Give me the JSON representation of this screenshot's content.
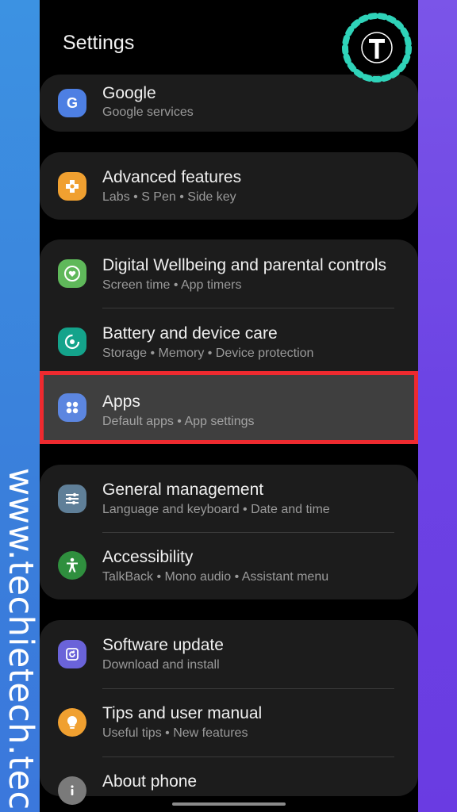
{
  "header": {
    "title": "Settings"
  },
  "watermark": {
    "text": "www.techietech.tech",
    "logo_letter": "T"
  },
  "colors": {
    "highlight_border": "#ee2a2f",
    "google_icon": "#4d7fe3",
    "advanced_icon": "#f0a030",
    "wellbeing_icon": "#5fb85a",
    "battery_icon": "#14a38b",
    "apps_icon": "#5c86e0",
    "general_icon": "#5f7f98",
    "accessibility_icon": "#2f8f3e",
    "software_icon": "#6a63d9",
    "tips_icon": "#f0a030",
    "about_icon": "#7a7a7a"
  },
  "items": [
    {
      "title": "Google",
      "subtitle": "Google services",
      "icon": "google-g-icon"
    },
    {
      "title": "Advanced features",
      "subtitle": "Labs  •  S Pen  •  Side key",
      "icon": "puzzle-plus-icon"
    },
    {
      "title": "Digital Wellbeing and parental controls",
      "subtitle": "Screen time  •  App timers",
      "icon": "wellbeing-heart-icon"
    },
    {
      "title": "Battery and device care",
      "subtitle": "Storage  •  Memory  •  Device protection",
      "icon": "device-care-icon"
    },
    {
      "title": "Apps",
      "subtitle": "Default apps  •  App settings",
      "icon": "apps-grid-icon"
    },
    {
      "title": "General management",
      "subtitle": "Language and keyboard  •  Date and time",
      "icon": "sliders-icon"
    },
    {
      "title": "Accessibility",
      "subtitle": "TalkBack  •  Mono audio  •  Assistant menu",
      "icon": "accessibility-person-icon"
    },
    {
      "title": "Software update",
      "subtitle": "Download and install",
      "icon": "software-update-icon"
    },
    {
      "title": "Tips and user manual",
      "subtitle": "Useful tips  •  New features",
      "icon": "lightbulb-icon"
    },
    {
      "title": "About phone",
      "subtitle": "",
      "icon": "info-icon"
    }
  ]
}
